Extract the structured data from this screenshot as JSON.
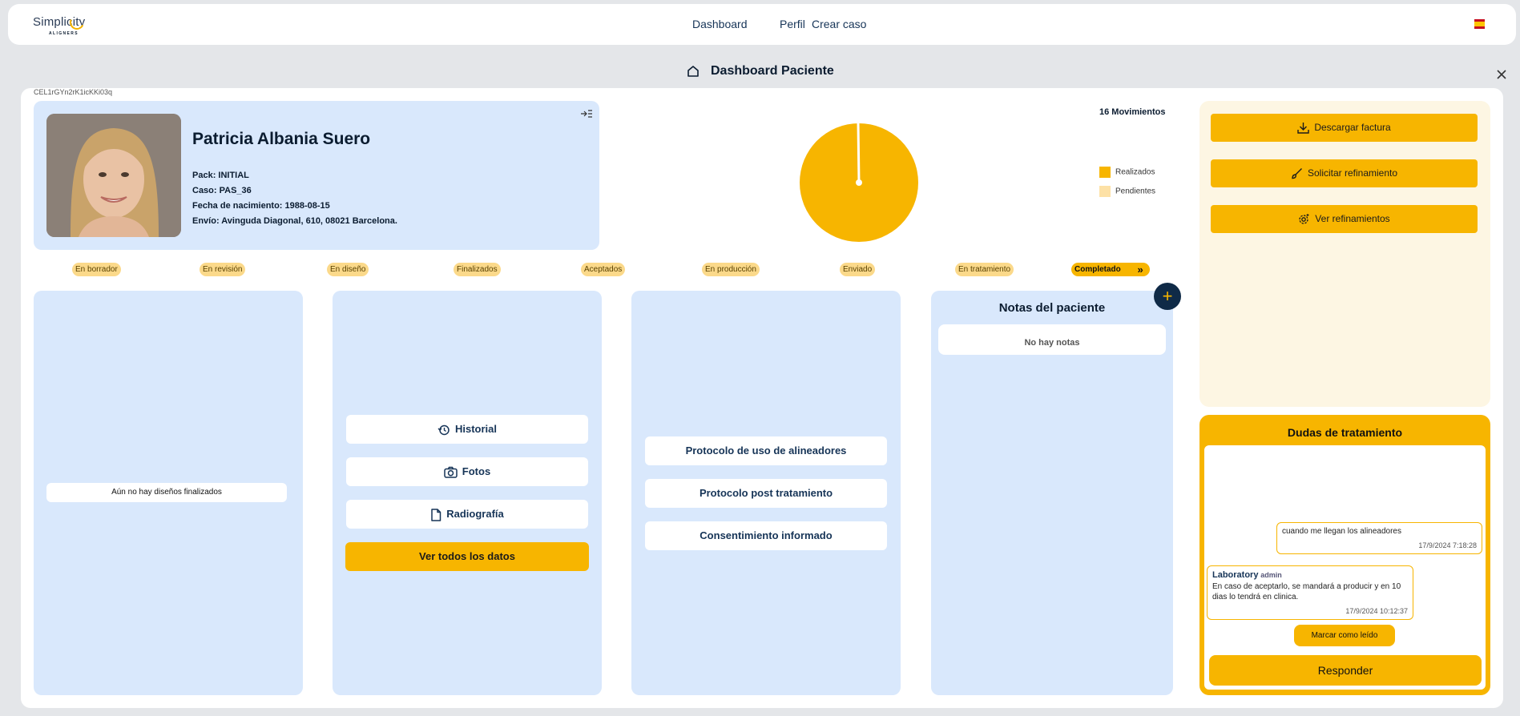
{
  "app": {
    "logo_text": "Simplicity",
    "logo_sub": "ALIGNERS",
    "nav": [
      "Dashboard",
      "Perfil",
      "Crear caso"
    ]
  },
  "page": {
    "title": "Dashboard Paciente",
    "case_id": "CEL1rGYn2rK1icKKi03q"
  },
  "patient": {
    "name": "Patricia Albania Suero",
    "pack": "Pack: INITIAL",
    "case": "Caso: PAS_36",
    "birth": "Fecha de nacimiento: 1988-08-15",
    "shipping": "Envío: Avinguda Diagonal, 610, 08021 Barcelona."
  },
  "chart_data": {
    "type": "pie",
    "title": "16 Movimientos",
    "categories": [
      "Realizados",
      "Pendientes"
    ],
    "values": [
      16,
      0
    ],
    "colors": [
      "#f7b500",
      "#fde1a6"
    ],
    "legend_position": "right"
  },
  "stages": [
    "En borrador",
    "En revisión",
    "En diseño",
    "Finalizados",
    "Aceptados",
    "En producción",
    "Enviado",
    "En tratamiento",
    "Completado"
  ],
  "designs": {
    "empty": "Aún no hay diseños finalizados"
  },
  "records": {
    "historial": "Historial",
    "fotos": "Fotos",
    "radiografia": "Radiografía",
    "ver_todos": "Ver todos los datos"
  },
  "protocols": {
    "uso": "Protocolo de uso de alineadores",
    "post": "Protocolo post tratamiento",
    "consent": "Consentimiento informado"
  },
  "notes": {
    "title": "Notas del paciente",
    "empty": "No hay notas",
    "add": "+"
  },
  "actions": {
    "factura": "Descargar factura",
    "refinamiento": "Solicitar refinamiento",
    "ver_refinamientos": "Ver refinamientos"
  },
  "doubts": {
    "title": "Dudas de tratamiento",
    "msg1": {
      "text": "cuando me llegan los alineadores",
      "time": "17/9/2024 7:18:28"
    },
    "msg2": {
      "author": "Laboratory",
      "role": "admin",
      "text": "En caso de aceptarlo, se mandará a producir y en 10 dias lo tendrá en clinica.",
      "time": "17/9/2024 10:12:37"
    },
    "mark_read": "Marcar como leído",
    "reply": "Responder"
  },
  "colors": {
    "accent": "#f7b500",
    "panel_blue": "#d9e8fc",
    "navy": "#0f2a47"
  }
}
